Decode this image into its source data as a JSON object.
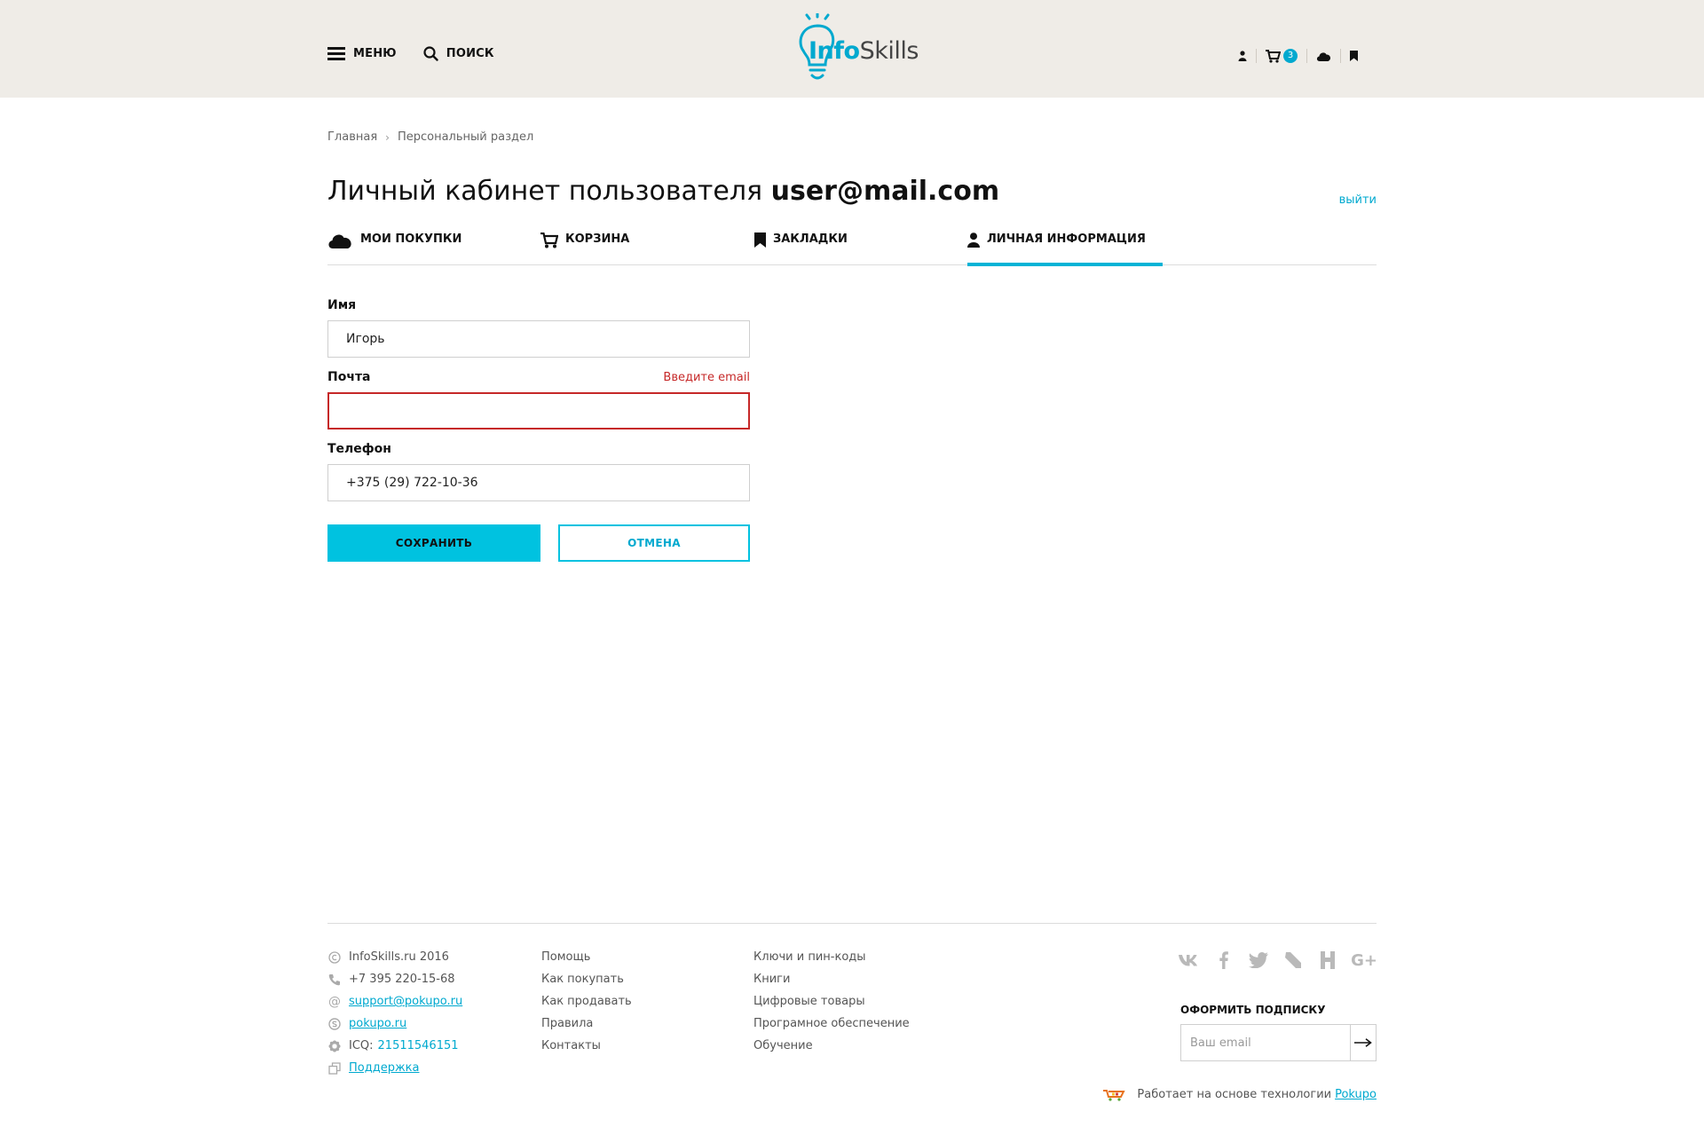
{
  "header": {
    "menu_label": "МЕНЮ",
    "search_label": "ПОИСК",
    "logo_part1": "Info",
    "logo_part2": "Skills",
    "cart_count": "3"
  },
  "breadcrumb": {
    "home": "Главная",
    "current": "Персональный раздел"
  },
  "page": {
    "title_prefix": "Личный кабинет пользователя",
    "user_email": "user@mail.com",
    "logout": "выйти"
  },
  "tabs": [
    {
      "label": "МОИ ПОКУПКИ",
      "icon": "cloud-icon"
    },
    {
      "label": "КОРЗИНА",
      "icon": "cart-icon"
    },
    {
      "label": "ЗАКЛАДКИ",
      "icon": "bookmark-icon"
    },
    {
      "label": "ЛИЧНАЯ ИНФОРМАЦИЯ",
      "icon": "user-icon",
      "active": true
    }
  ],
  "form": {
    "name_label": "Имя",
    "name_value": "Игорь",
    "email_label": "Почта",
    "email_error": "Введите email",
    "email_value": "",
    "phone_label": "Телефон",
    "phone_value": "+375 (29) 722-10-36",
    "save": "СОХРАНИТЬ",
    "cancel": "ОТМЕНА"
  },
  "footer": {
    "contacts": {
      "copyright": "InfoSkills.ru 2016",
      "phone": "+7 395 220-15-68",
      "email": "support@pokupo.ru",
      "skype": "pokupo.ru",
      "icq_label": "ICQ:",
      "icq_number": "21511546151",
      "support": "Поддержка"
    },
    "col2": [
      "Помощь",
      "Как покупать",
      "Как продавать",
      "Правила",
      "Контакты"
    ],
    "col3": [
      "Ключи и пин-коды",
      "Книги",
      "Цифровые товары",
      "Програмное обеспечение",
      "Обучение"
    ],
    "subscribe_title": "ОФОРМИТЬ ПОДПИСКУ",
    "subscribe_placeholder": "Ваш email",
    "powered_text": "Работает на основе технологии",
    "powered_link": "Pokupo"
  },
  "colors": {
    "accent": "#00c2e0",
    "link": "#00a9cf",
    "error": "#c62828",
    "header_bg": "#efece7"
  }
}
